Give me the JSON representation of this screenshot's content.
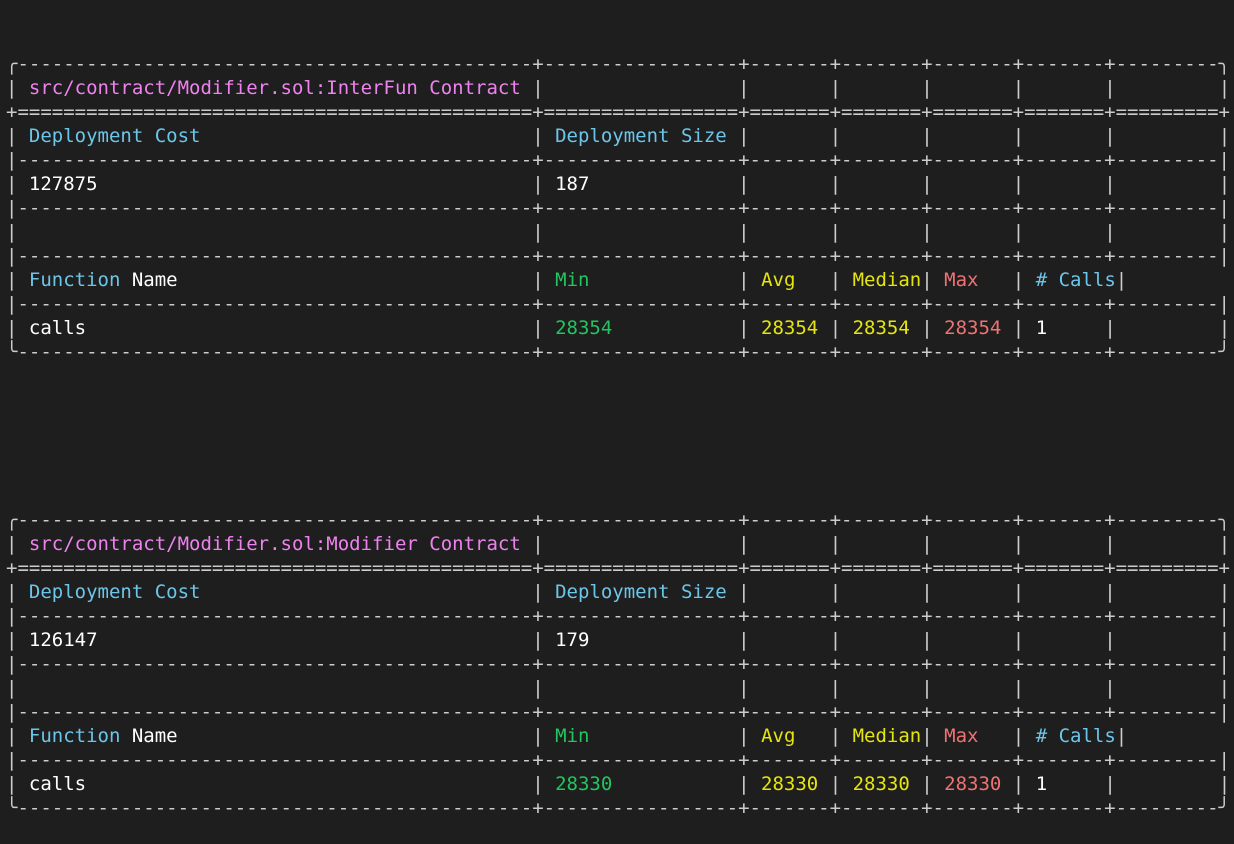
{
  "reports": [
    {
      "title": "src/contract/Modifier.sol:InterFun Contract",
      "headers": {
        "deployment_cost": "Deployment Cost",
        "deployment_size": "Deployment Size",
        "function_word": "Function",
        "name_word": "Name",
        "min": "Min",
        "avg": "Avg",
        "median": "Median",
        "max": "Max",
        "calls": "# Calls"
      },
      "deployment": {
        "cost": "127875",
        "size": "187"
      },
      "functions": [
        {
          "name": "calls",
          "min": "28354",
          "avg": "28354",
          "median": "28354",
          "max": "28354",
          "calls": "1"
        }
      ]
    },
    {
      "title": "src/contract/Modifier.sol:Modifier Contract",
      "headers": {
        "deployment_cost": "Deployment Cost",
        "deployment_size": "Deployment Size",
        "function_word": "Function",
        "name_word": "Name",
        "min": "Min",
        "avg": "Avg",
        "median": "Median",
        "max": "Max",
        "calls": "# Calls"
      },
      "deployment": {
        "cost": "126147",
        "size": "179"
      },
      "functions": [
        {
          "name": "calls",
          "min": "28330",
          "avg": "28330",
          "median": "28330",
          "max": "28330",
          "calls": "1"
        }
      ]
    }
  ]
}
